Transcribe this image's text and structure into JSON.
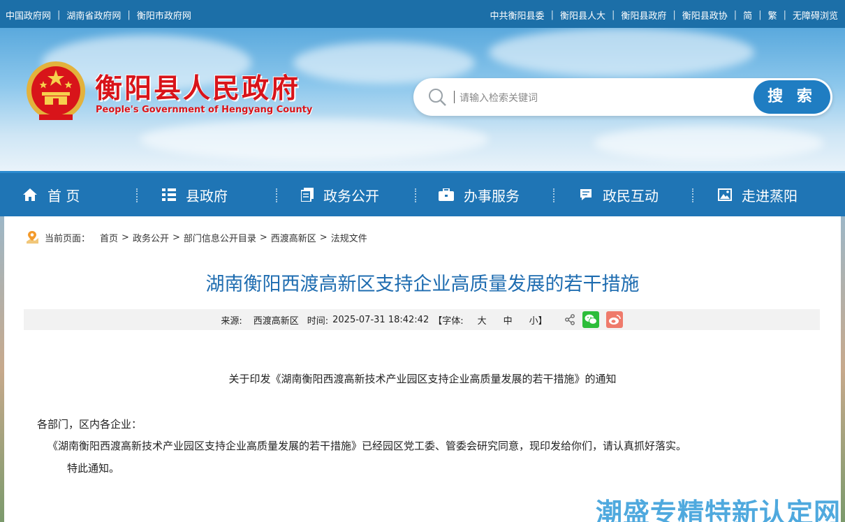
{
  "topbar": {
    "left_links": [
      "中国政府网",
      "湖南省政府网",
      "衡阳市政府网"
    ],
    "right_links": [
      "中共衡阳县委",
      "衡阳县人大",
      "衡阳县政府",
      "衡阳县政协",
      "简",
      "繁",
      "无障碍浏览"
    ],
    "separator": "|"
  },
  "header": {
    "site_name": "衡阳县人民政府",
    "site_name_en": "People's Government of Hengyang County"
  },
  "search": {
    "placeholder": "请输入检索关键词",
    "button_label": "搜 索"
  },
  "nav": {
    "items": [
      {
        "label": "首 页",
        "icon": "home-icon"
      },
      {
        "label": "县政府",
        "icon": "list-icon"
      },
      {
        "label": "政务公开",
        "icon": "document-icon"
      },
      {
        "label": "办事服务",
        "icon": "briefcase-icon"
      },
      {
        "label": "政民互动",
        "icon": "chat-icon"
      },
      {
        "label": "走进蒸阳",
        "icon": "picture-icon"
      }
    ]
  },
  "breadcrumb": {
    "label": "当前页面：",
    "items": [
      "首页",
      "政务公开",
      "部门信息公开目录",
      "西渡高新区",
      "法规文件"
    ]
  },
  "article": {
    "title": "湖南衡阳西渡高新区支持企业高质量发展的若干措施",
    "meta": {
      "source_label": "来源:",
      "source": "西渡高新区",
      "time_label": "时间:",
      "time": "2025-07-31 18:42:42",
      "font_label": "【字体:",
      "font_large": "大",
      "font_medium": "中",
      "font_small": "小】"
    },
    "notice_title": "关于印发《湖南衡阳西渡高新技术产业园区支持企业高质量发展的若干措施》的通知",
    "salutation": "各部门，区内各企业：",
    "body": "《湖南衡阳西渡高新技术产业园区支持企业高质量发展的若干措施》已经园区党工委、管委会研究同意，现印发给你们，请认真抓好落实。",
    "closing": "特此通知。"
  },
  "watermark": "潮盛专精特新认定网",
  "colors": {
    "topbar": "#1c6fa8",
    "nav": "#1f75b5",
    "title_red": "#d8141a",
    "article_title": "#1e6cb0",
    "search_button": "#1f7dc2"
  }
}
